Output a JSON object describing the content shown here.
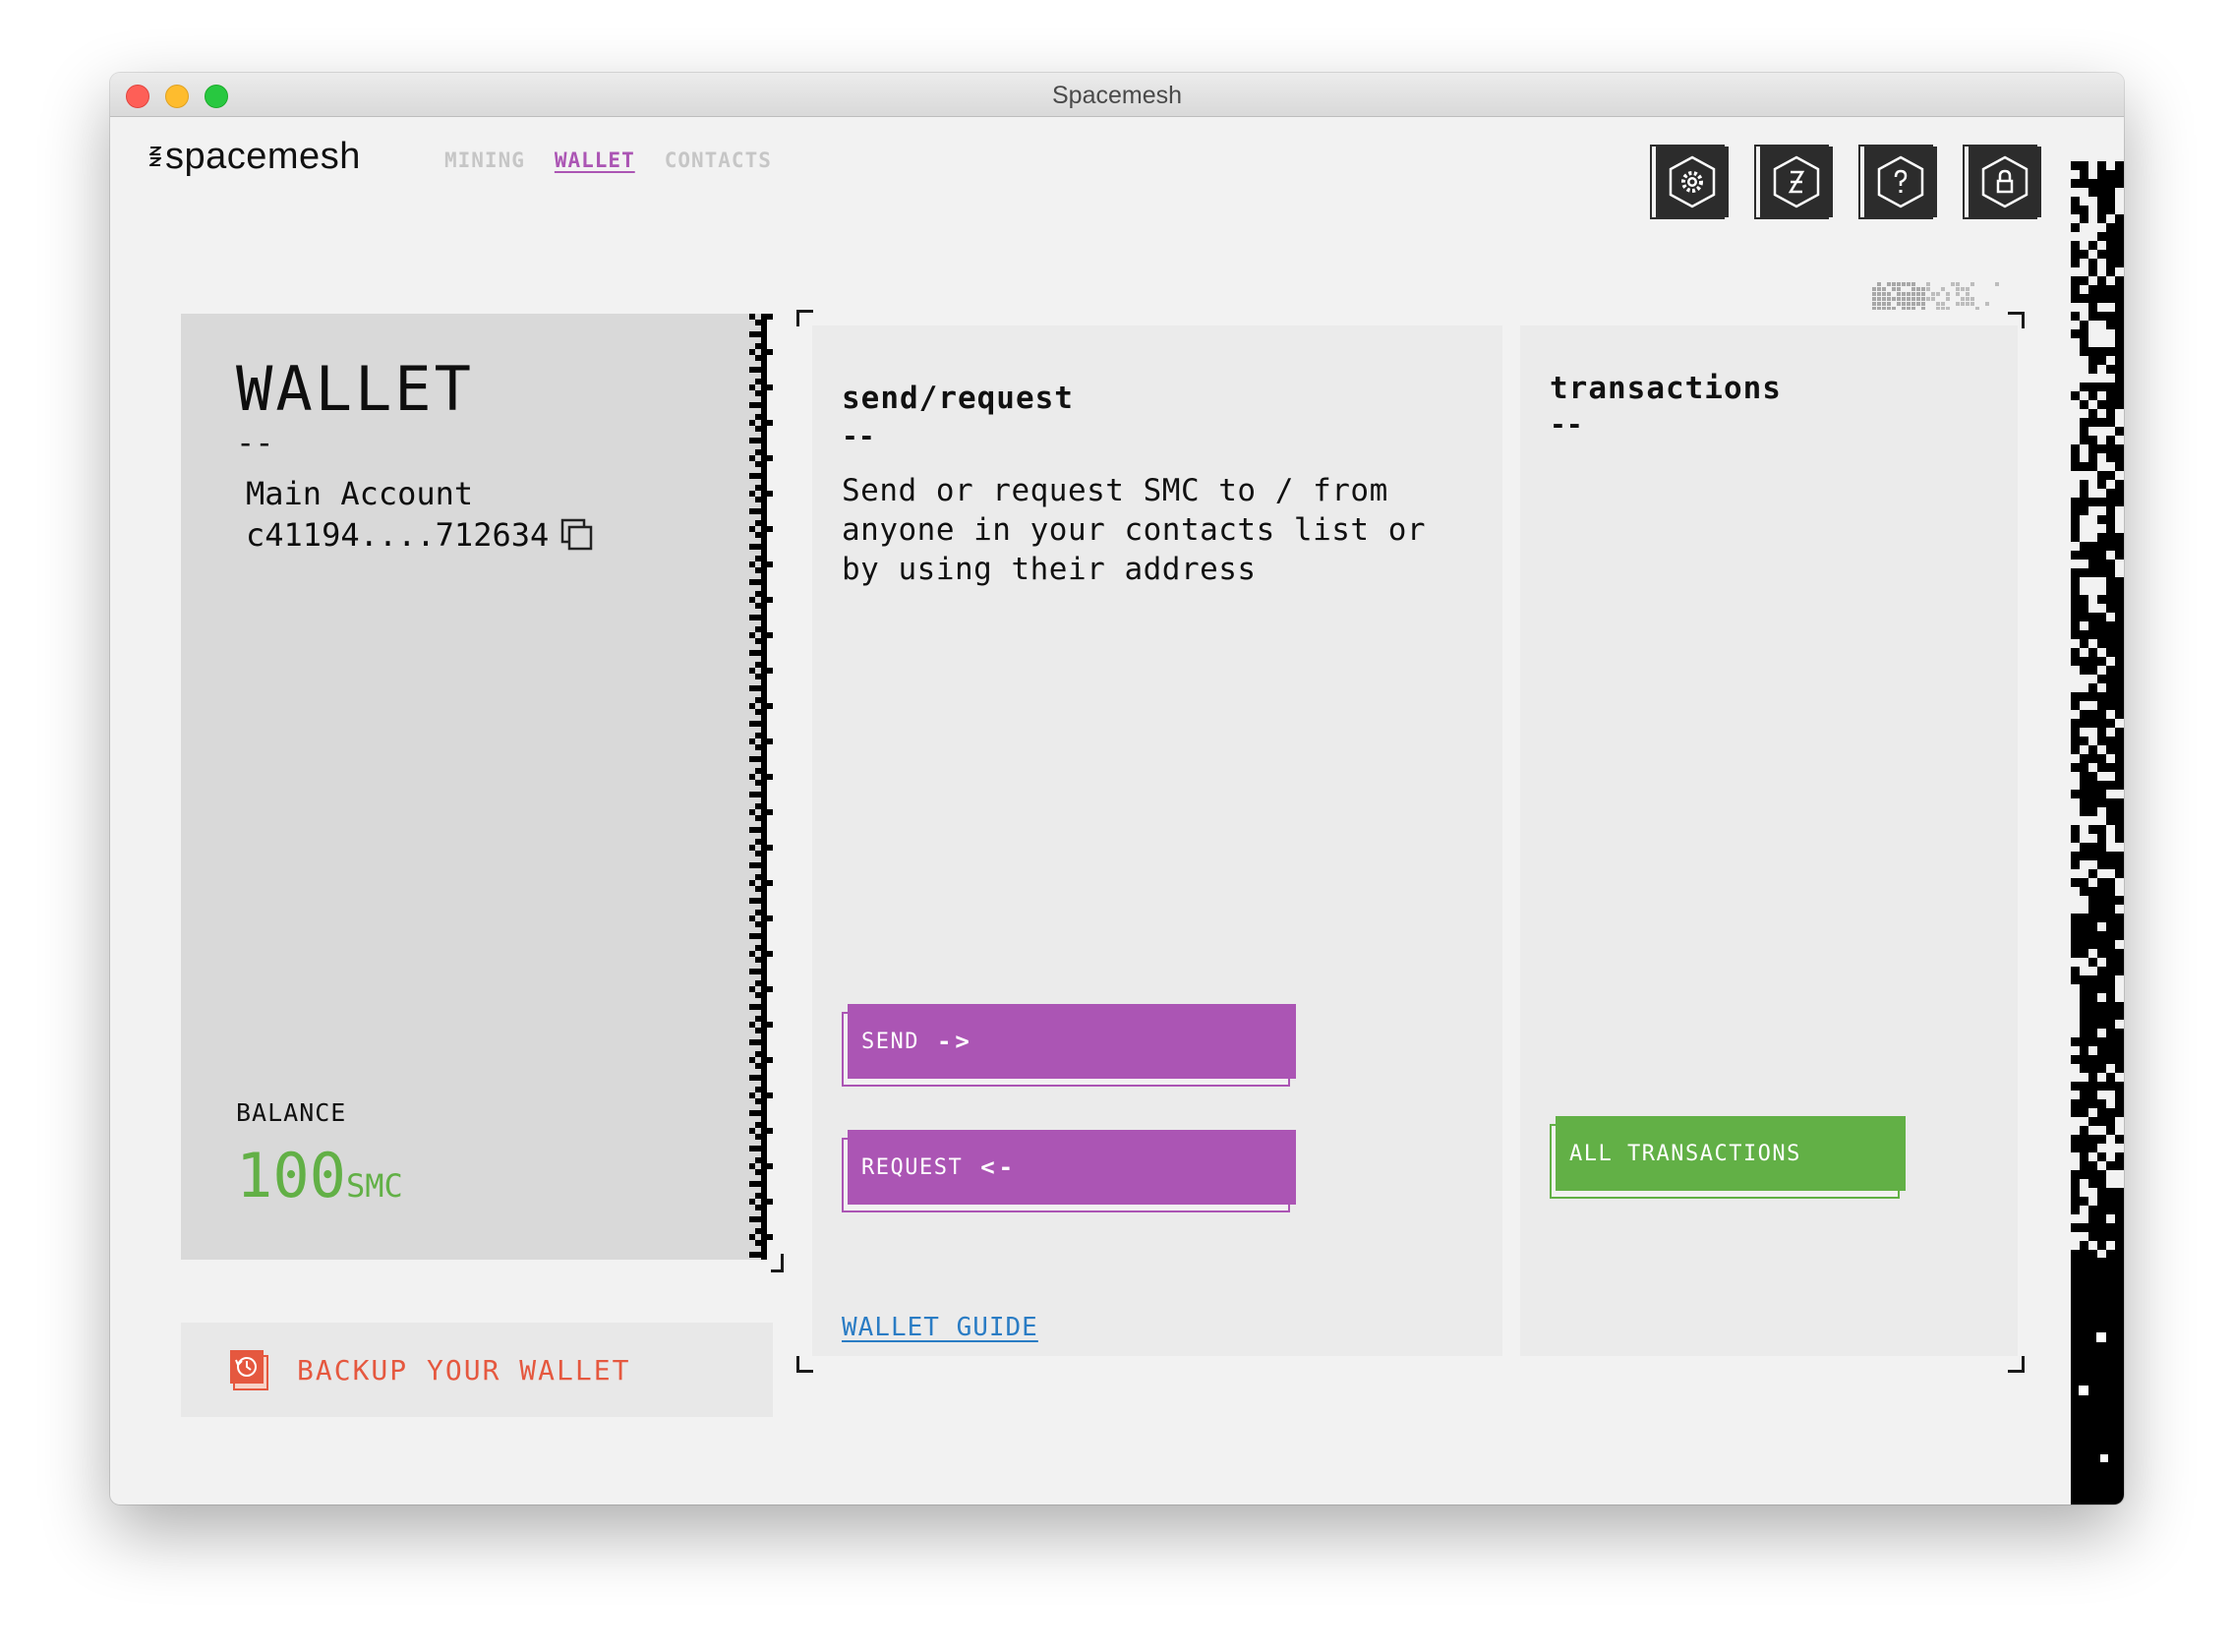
{
  "window": {
    "title": "Spacemesh"
  },
  "header": {
    "logo_text": "spacemesh",
    "nav": [
      {
        "label": "MINING",
        "active": false
      },
      {
        "label": "WALLET",
        "active": true
      },
      {
        "label": "CONTACTS",
        "active": false
      }
    ],
    "icons": [
      "settings-icon",
      "network-hourglass-icon",
      "help-icon",
      "lock-icon"
    ]
  },
  "wallet": {
    "title": "WALLET",
    "dash": "--",
    "account_name": "Main Account",
    "account_address": "c41194....712634",
    "balance_label": "BALANCE",
    "balance_value": "100",
    "balance_unit": "SMC",
    "backup_label": "BACKUP YOUR WALLET"
  },
  "send_request": {
    "title": "send/request",
    "dash": "--",
    "description": "Send or request SMC to / from anyone in your contacts list or by using their address",
    "send_label": "SEND",
    "send_arrow": "->",
    "request_label": "REQUEST",
    "request_arrow": "<-",
    "guide_link": "WALLET GUIDE"
  },
  "transactions": {
    "title": "transactions",
    "dash": "--",
    "all_label": "ALL TRANSACTIONS"
  },
  "colors": {
    "accent_purple": "#ab55b4",
    "accent_green": "#62b046",
    "backup_red": "#e5583f",
    "link_blue": "#2a7cc4"
  }
}
